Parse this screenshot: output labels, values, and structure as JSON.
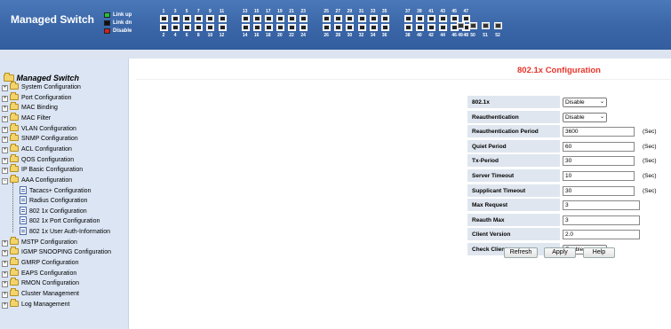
{
  "app": {
    "title": "Managed Switch"
  },
  "legend": [
    {
      "label": "Link up",
      "color": "#22c13a"
    },
    {
      "label": "Link dn",
      "color": "#111111"
    },
    {
      "label": "Disable",
      "color": "#d02020"
    }
  ],
  "ports": {
    "top_numbers": [
      "1",
      "3",
      "5",
      "7",
      "9",
      "11",
      "13",
      "15",
      "17",
      "19",
      "21",
      "23",
      "25",
      "27",
      "29",
      "31",
      "33",
      "35",
      "37",
      "39",
      "41",
      "43",
      "45",
      "47"
    ],
    "bottom_numbers": [
      "2",
      "4",
      "6",
      "8",
      "10",
      "12",
      "14",
      "16",
      "18",
      "20",
      "22",
      "24",
      "26",
      "28",
      "30",
      "32",
      "34",
      "36",
      "38",
      "40",
      "42",
      "44",
      "46",
      "48"
    ],
    "fiber_numbers": [
      "49",
      "50",
      "51",
      "52"
    ]
  },
  "sidebar": {
    "root": "Managed Switch",
    "items": [
      {
        "label": "System Configuration",
        "type": "folder"
      },
      {
        "label": "Port Configuration",
        "type": "folder"
      },
      {
        "label": "MAC Binding",
        "type": "folder"
      },
      {
        "label": "MAC Filter",
        "type": "folder"
      },
      {
        "label": "VLAN Configuration",
        "type": "folder"
      },
      {
        "label": "SNMP Configuration",
        "type": "folder"
      },
      {
        "label": "ACL Configuration",
        "type": "folder"
      },
      {
        "label": "QOS Configuration",
        "type": "folder"
      },
      {
        "label": "IP Basic Configuration",
        "type": "folder"
      },
      {
        "label": "AAA Configuration",
        "type": "folder-open"
      },
      {
        "label": "Tacacs+ Configuration",
        "type": "page"
      },
      {
        "label": "Radius Configuration",
        "type": "page"
      },
      {
        "label": "802 1x Configuration",
        "type": "page"
      },
      {
        "label": "802 1x Port Configuration",
        "type": "page"
      },
      {
        "label": "802 1x User Auth-Information",
        "type": "page"
      },
      {
        "label": "MSTP Configuration",
        "type": "folder"
      },
      {
        "label": "IGMP SNOOPING Configuration",
        "type": "folder"
      },
      {
        "label": "GMRP Configuration",
        "type": "folder"
      },
      {
        "label": "EAPS Configuration",
        "type": "folder"
      },
      {
        "label": "RMON Configuration",
        "type": "folder"
      },
      {
        "label": "Cluster Management",
        "type": "folder"
      },
      {
        "label": "Log Management",
        "type": "folder"
      }
    ]
  },
  "main": {
    "title": "802.1x Configuration",
    "rows": [
      {
        "label": "802.1x",
        "kind": "select",
        "value": "Disable"
      },
      {
        "label": "Reauthentication",
        "kind": "select",
        "value": "Disable"
      },
      {
        "label": "Reauthentication Period",
        "kind": "input",
        "value": "3600",
        "unit": "(Sec)"
      },
      {
        "label": "Quiet Period",
        "kind": "input",
        "value": "60",
        "unit": "(Sec)"
      },
      {
        "label": "Tx-Period",
        "kind": "input",
        "value": "30",
        "unit": "(Sec)"
      },
      {
        "label": "Server Timeout",
        "kind": "input",
        "value": "10",
        "unit": "(Sec)"
      },
      {
        "label": "Supplicant Timeout",
        "kind": "input",
        "value": "30",
        "unit": "(Sec)"
      },
      {
        "label": "Max Request",
        "kind": "input",
        "value": "3",
        "unit": ""
      },
      {
        "label": "Reauth Max",
        "kind": "input",
        "value": "3",
        "unit": ""
      },
      {
        "label": "Client Version",
        "kind": "input",
        "value": "2.0",
        "unit": ""
      },
      {
        "label": "Check Client",
        "kind": "select",
        "value": "Enable"
      }
    ],
    "buttons": {
      "refresh": "Refresh",
      "apply": "Apply",
      "help": "Help"
    }
  }
}
